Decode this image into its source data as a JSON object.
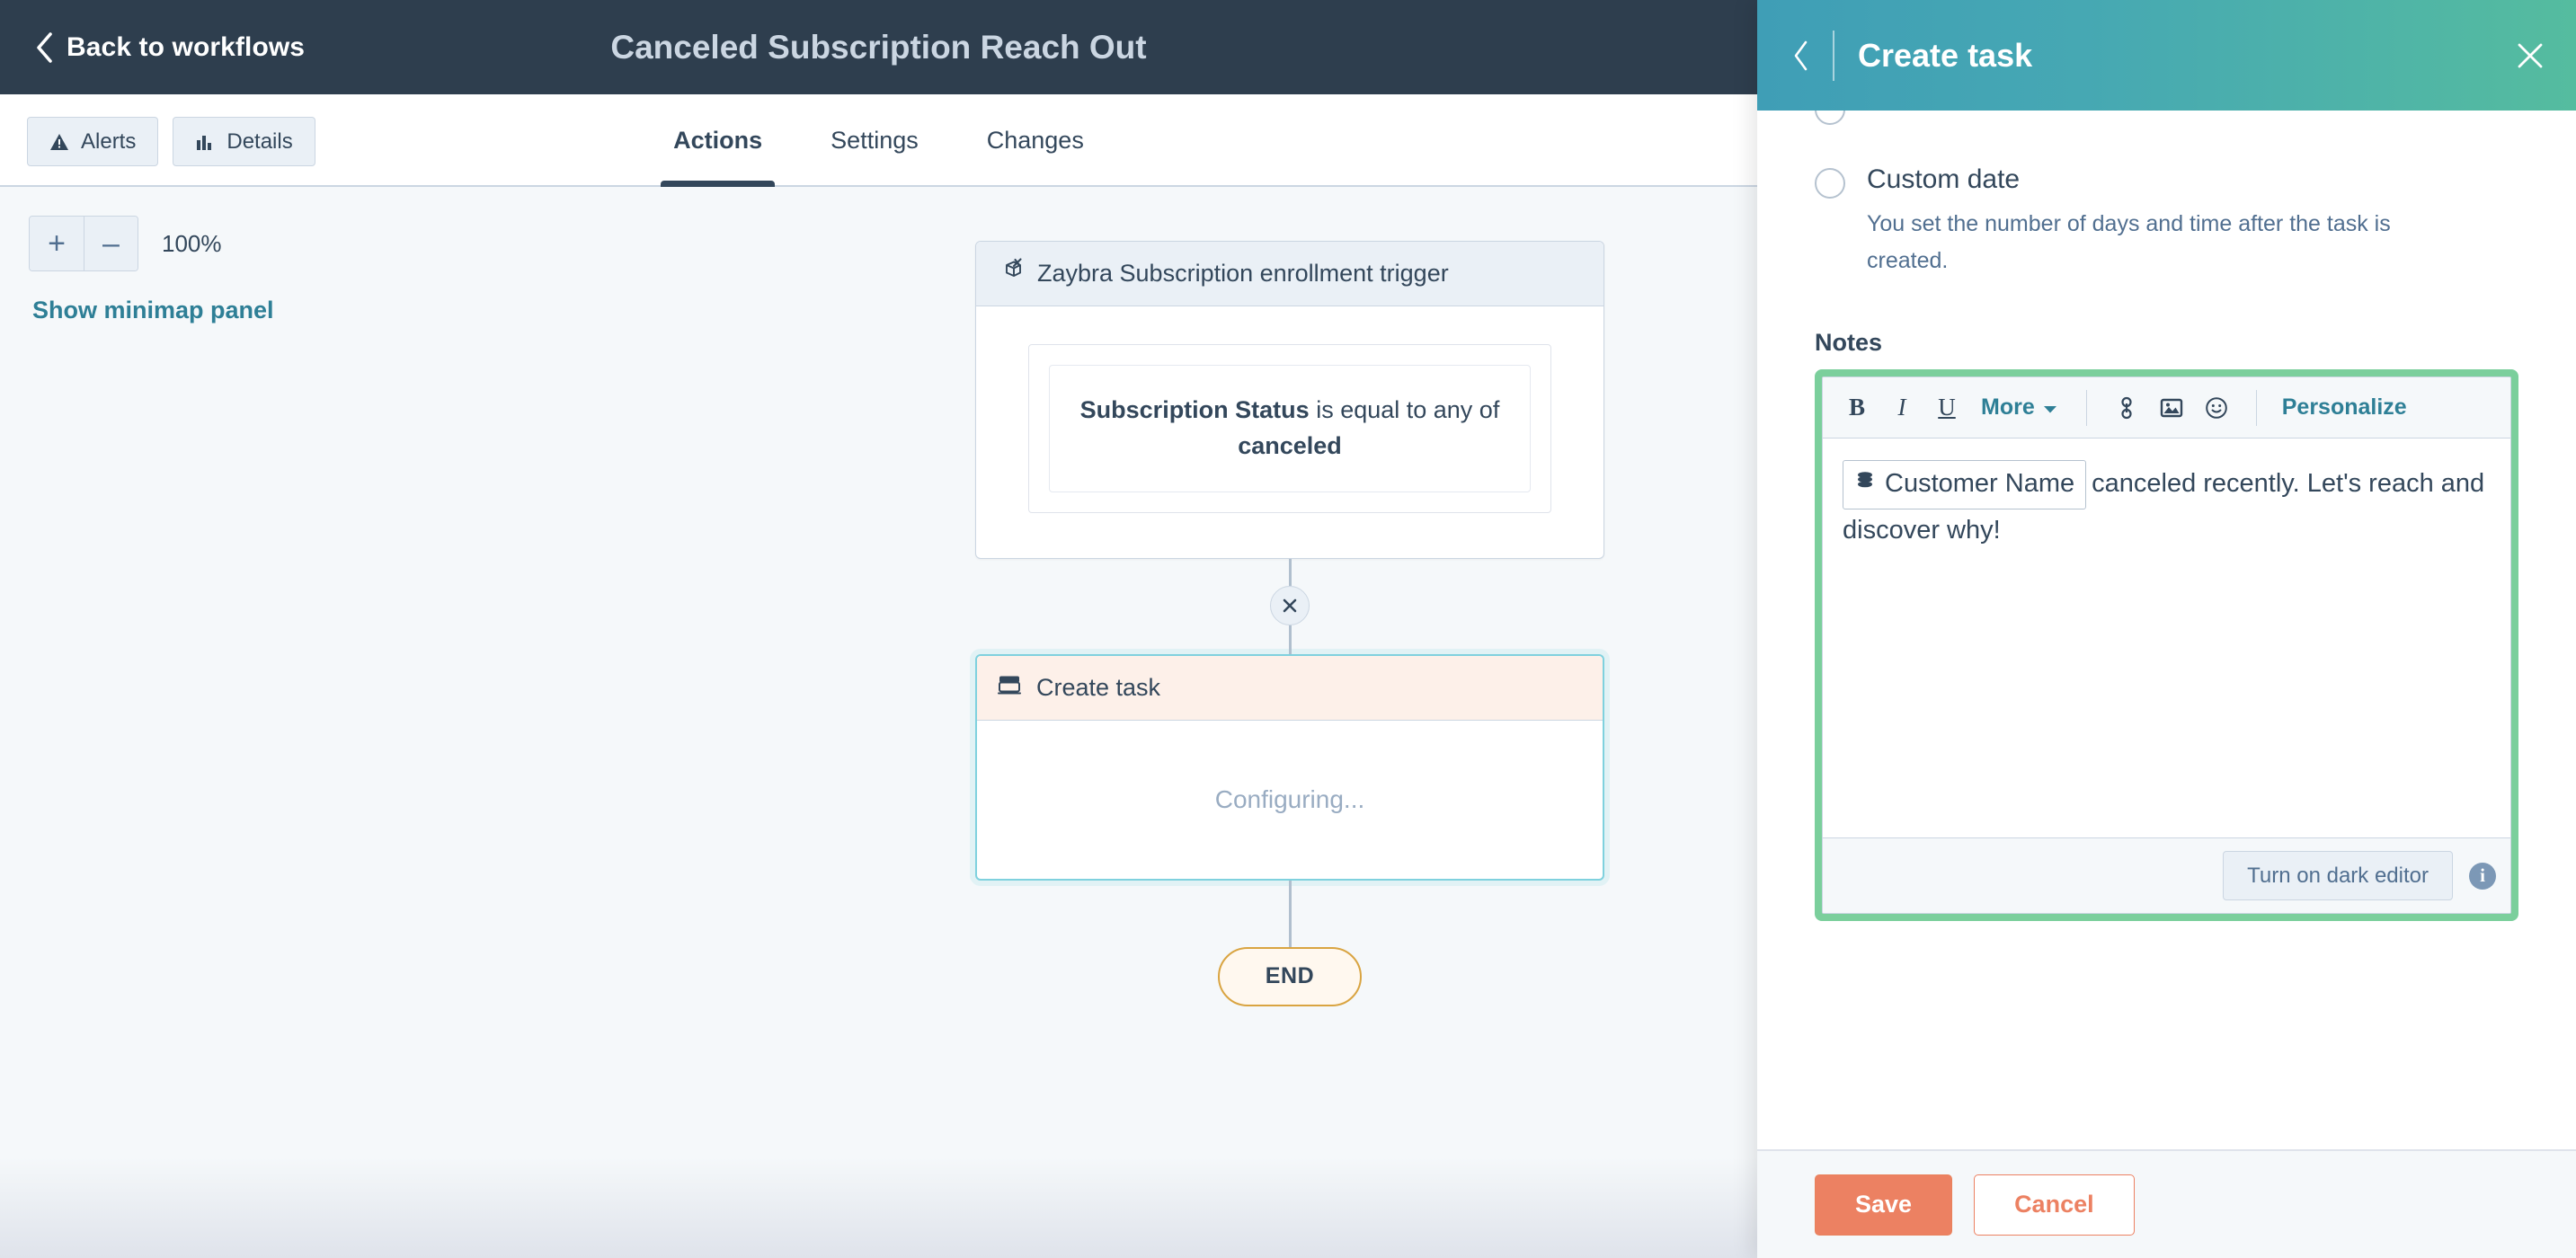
{
  "topbar": {
    "back_label": "Back to workflows",
    "workflow_title": "Canceled Subscription Reach Out"
  },
  "subheader": {
    "alerts_label": "Alerts",
    "details_label": "Details",
    "tabs": [
      {
        "label": "Actions",
        "active": true
      },
      {
        "label": "Settings",
        "active": false
      },
      {
        "label": "Changes",
        "active": false
      }
    ]
  },
  "canvas": {
    "zoom_in": "+",
    "zoom_out": "–",
    "zoom_level": "100%",
    "minimap_link": "Show minimap panel",
    "trigger_node": {
      "title": "Zaybra Subscription enrollment trigger",
      "condition_property": "Subscription Status",
      "condition_operator": " is equal to any of ",
      "condition_value": "canceled"
    },
    "action_node": {
      "title": "Create task",
      "status": "Configuring..."
    },
    "end_node": {
      "label": "END"
    }
  },
  "panel": {
    "title": "Create task",
    "due_date": {
      "custom_option_label": "Custom date",
      "custom_option_desc": "You set the number of days and time after the task is created."
    },
    "notes": {
      "label": "Notes",
      "toolbar": {
        "bold": "B",
        "italic": "I",
        "underline": "U",
        "more": "More",
        "personalize": "Personalize"
      },
      "token_label": "Customer Name",
      "body_text": "canceled recently. Let's reach and discover why!",
      "dark_editor_label": "Turn on dark editor"
    },
    "footer": {
      "save_label": "Save",
      "cancel_label": "Cancel"
    }
  },
  "colors": {
    "topbar_bg": "#2e3e4e",
    "panel_header_from": "#3f9eb6",
    "panel_header_to": "#55bc9f",
    "focus_green": "#7bcf9c",
    "primary_orange": "#ec8162",
    "link_teal": "#2e7f96",
    "end_border": "#d9a441",
    "selected_blue": "#7fd1de"
  }
}
